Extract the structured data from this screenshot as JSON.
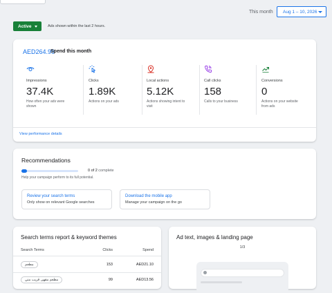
{
  "header": {
    "period_label": "This month",
    "date_range": "Aug 1 – 10, 2026"
  },
  "status": {
    "label": "Active",
    "note": "Ads shown within the last 2 hours."
  },
  "spend": {
    "amount": "AED264.99",
    "label": "Spend this month",
    "link": "View performance details",
    "metrics": [
      {
        "icon": "eye-icon",
        "label": "Impressions",
        "value": "37.4K",
        "description": "How often your ads were shown",
        "color": "#1a73e8"
      },
      {
        "icon": "click-icon",
        "label": "Clicks",
        "value": "1.89K",
        "description": "Actions on your ads",
        "color": "#1a73e8"
      },
      {
        "icon": "location-pin-icon",
        "label": "Local actions",
        "value": "5.12K",
        "description": "Actions showing intent to visit",
        "color": "#d93025"
      },
      {
        "icon": "phone-call-icon",
        "label": "Call clicks",
        "value": "158",
        "description": "Calls to your business",
        "color": "#9334e6"
      },
      {
        "icon": "trending-up-icon",
        "label": "Conversions",
        "value": "0",
        "description": "Actions on your website from ads",
        "color": "#188038"
      }
    ]
  },
  "recommendations": {
    "title": "Recommendations",
    "progress_count": "0 of 2",
    "progress_suffix": "complete",
    "progress_fraction": 0.1,
    "caption": "Help your campaign perform to its full potential.",
    "items": [
      {
        "title": "Review your search terms",
        "subtitle": "Only show on relevant Google searches"
      },
      {
        "title": "Download the mobile app",
        "subtitle": "Manage your campaign on the go"
      }
    ]
  },
  "search_terms": {
    "title": "Search terms report & keyword themes",
    "columns": [
      "Search Terms",
      "Clicks",
      "Spend"
    ],
    "rows": [
      {
        "term": "مطعم",
        "clicks": "153",
        "spend": "AED21.10"
      },
      {
        "term": "مطعم مقهى قريب مني",
        "clicks": "99",
        "spend": "AED13.56"
      }
    ]
  },
  "ad_preview": {
    "title": "Ad text, images & landing page",
    "counter": "1/3"
  }
}
